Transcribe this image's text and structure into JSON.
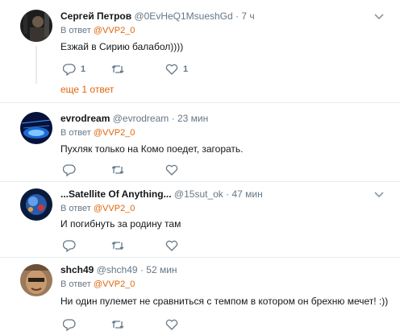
{
  "tweets": [
    {
      "name": "Сергей Петров",
      "handle": "@0EvHeQ1MsueshGd",
      "dot": "·",
      "time": "7 ч",
      "reply_label": "В ответ",
      "reply_mention": "@VVP2_0",
      "text": "Езжай в Сирию балабол))))",
      "reply_count": "1",
      "retweet_count": "",
      "like_count": "1",
      "more_replies": "еще 1 ответ"
    },
    {
      "name": "evrodream",
      "handle": "@evrodream",
      "dot": "·",
      "time": "23 мин",
      "reply_label": "В ответ",
      "reply_mention": "@VVP2_0",
      "text": "Пухляк только на Комо поедет, загорать.",
      "reply_count": "",
      "retweet_count": "",
      "like_count": ""
    },
    {
      "name": "...Satellite Of Anything...",
      "handle": "@15sut_ok",
      "dot": "·",
      "time": "47 мин",
      "reply_label": "В ответ",
      "reply_mention": "@VVP2_0",
      "text": "И погибнуть за родину там",
      "reply_count": "",
      "retweet_count": "",
      "like_count": ""
    },
    {
      "name": "shch49",
      "handle": "@shch49",
      "dot": "·",
      "time": "52 мин",
      "reply_label": "В ответ",
      "reply_mention": "@VVP2_0",
      "text": "Ни один пулемет не сравниться с темпом в котором он брехню мечет! :))",
      "reply_count": "",
      "retweet_count": "",
      "like_count": ""
    }
  ],
  "icons": {
    "reply": "reply-icon",
    "retweet": "retweet-icon",
    "like": "heart-icon",
    "menu": "chevron-down-icon"
  },
  "colors": {
    "accent": "#e0660a",
    "muted": "#657786",
    "text": "#14171a",
    "divider": "#e6ecf0"
  }
}
